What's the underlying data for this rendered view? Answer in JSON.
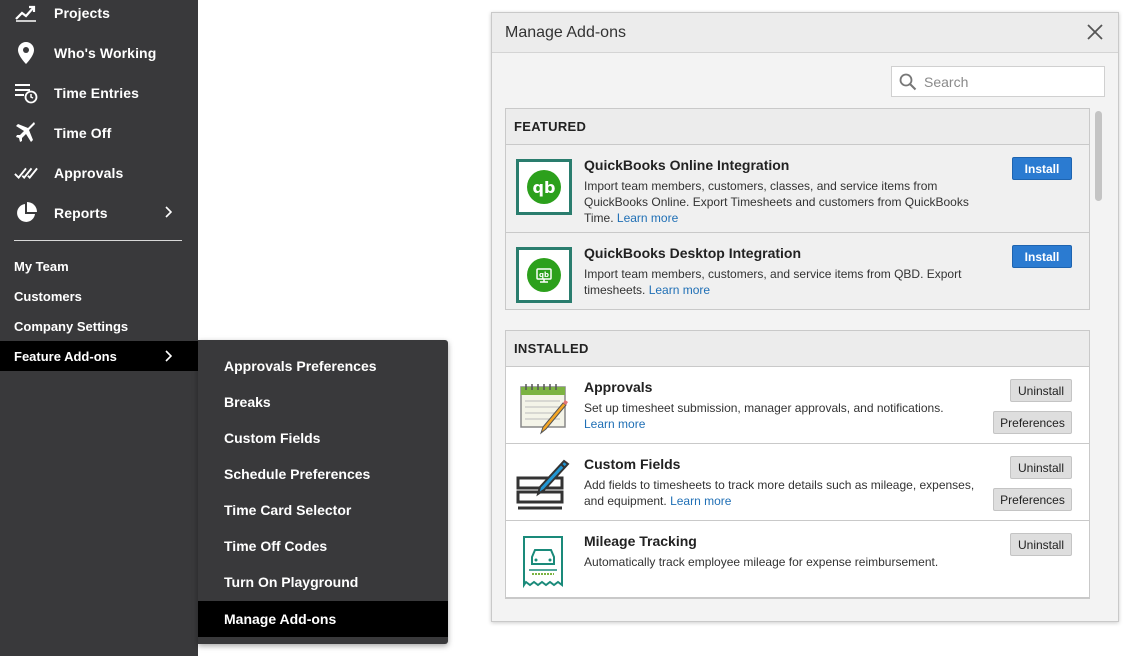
{
  "sidebar": {
    "items": [
      {
        "label": "Projects",
        "icon": "projects-icon"
      },
      {
        "label": "Who's Working",
        "icon": "location-pin-icon"
      },
      {
        "label": "Time Entries",
        "icon": "time-entries-icon"
      },
      {
        "label": "Time Off",
        "icon": "airplane-icon"
      },
      {
        "label": "Approvals",
        "icon": "checkmarks-icon"
      },
      {
        "label": "Reports",
        "icon": "pie-chart-icon"
      }
    ],
    "sub_items": [
      "My Team",
      "Customers",
      "Company Settings",
      "Feature Add-ons"
    ]
  },
  "flyout": {
    "items": [
      "Approvals Preferences",
      "Breaks",
      "Custom Fields",
      "Schedule Preferences",
      "Time Card Selector",
      "Time Off Codes",
      "Turn On Playground",
      "Manage Add-ons"
    ]
  },
  "modal": {
    "title": "Manage Add-ons",
    "search_placeholder": "Search",
    "featured": {
      "heading": "FEATURED",
      "items": [
        {
          "title": "QuickBooks Online Integration",
          "desc": "Import team members, customers, classes, and service items from QuickBooks Online. Export Timesheets and customers from QuickBooks Time.",
          "link": "Learn more",
          "button": "Install"
        },
        {
          "title": "QuickBooks Desktop Integration",
          "desc": "Import team members, customers, and service items from QBD. Export timesheets.",
          "link": "Learn more",
          "button": "Install"
        }
      ]
    },
    "installed": {
      "heading": "INSTALLED",
      "items": [
        {
          "title": "Approvals",
          "desc": "Set up timesheet submission, manager approvals, and notifications.",
          "link": "Learn more",
          "uninstall": "Uninstall",
          "preferences": "Preferences"
        },
        {
          "title": "Custom Fields",
          "desc": "Add fields to timesheets to track more details such as mileage, expenses, and equipment.",
          "link": "Learn more",
          "uninstall": "Uninstall",
          "preferences": "Preferences"
        },
        {
          "title": "Mileage Tracking",
          "desc": "Automatically track employee mileage for expense reimbursement.",
          "uninstall": "Uninstall"
        }
      ]
    }
  },
  "colors": {
    "sidebar_bg": "#39393b",
    "active_bg": "#000000",
    "install_blue": "#2b7bd1",
    "link_blue": "#1f6fb5",
    "qb_green": "#2ca01c"
  }
}
